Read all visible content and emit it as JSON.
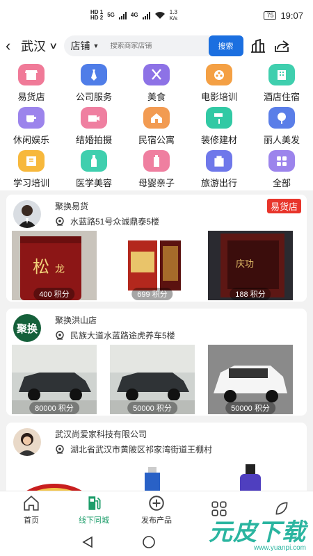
{
  "status_bar": {
    "hd1": "HD 1",
    "hd2": "HD 2",
    "net1": "5G",
    "net2": "4G",
    "speed": "1.3",
    "speed_unit": "K/s",
    "battery": "75",
    "time": "19:07"
  },
  "header": {
    "city": "武汉",
    "search_scope": "店铺",
    "search_placeholder": "搜索商家店铺",
    "search_button": "搜索"
  },
  "categories": [
    {
      "label": "易货店",
      "color": "#f07a98",
      "icon": "shop-icon"
    },
    {
      "label": "公司服务",
      "color": "#4f7de8",
      "icon": "tie-icon"
    },
    {
      "label": "美食",
      "color": "#8d72e6",
      "icon": "utensils-icon"
    },
    {
      "label": "电影培训",
      "color": "#f4a044",
      "icon": "film-reel-icon"
    },
    {
      "label": "酒店住宿",
      "color": "#3fcfae",
      "icon": "hotel-icon"
    },
    {
      "label": "休闲娱乐",
      "color": "#9c84ec",
      "icon": "coffee-icon"
    },
    {
      "label": "结婚拍摄",
      "color": "#ef7fa0",
      "icon": "camera-icon"
    },
    {
      "label": "民宿公寓",
      "color": "#f29b52",
      "icon": "house-icon"
    },
    {
      "label": "装修建材",
      "color": "#31c9a4",
      "icon": "paint-roller-icon"
    },
    {
      "label": "丽人美发",
      "color": "#5a7ee8",
      "icon": "mirror-icon"
    },
    {
      "label": "学习培训",
      "color": "#f7b83c",
      "icon": "book-icon"
    },
    {
      "label": "医学美容",
      "color": "#3fcfae",
      "icon": "bottle-icon"
    },
    {
      "label": "母婴亲子",
      "color": "#ef7fa0",
      "icon": "baby-bottle-icon"
    },
    {
      "label": "旅游出行",
      "color": "#6f78ea",
      "icon": "luggage-icon"
    },
    {
      "label": "全部",
      "color": "#9c84ec",
      "icon": "grid-icon"
    }
  ],
  "shops": [
    {
      "name": "聚换易货",
      "address": "水蓝路51号众诚鼎泰5楼",
      "tag": "易货店",
      "avatar": "person",
      "products": [
        {
          "points": "400 积分",
          "kind": "tea-can"
        },
        {
          "points": "699 积分",
          "kind": "liquor-box"
        },
        {
          "points": "188 积分",
          "kind": "wine-box"
        }
      ]
    },
    {
      "name": "聚换洪山店",
      "address": "民族大道水蓝路途虎养车5楼",
      "tag": "",
      "avatar_text": "聚换",
      "avatar": "logo",
      "products": [
        {
          "points": "80000 积分",
          "kind": "suv-dark"
        },
        {
          "points": "50000 积分",
          "kind": "suv-dark"
        },
        {
          "points": "50000 积分",
          "kind": "suv-white"
        }
      ]
    },
    {
      "name": "武汉尚爱家科技有限公司",
      "address": "湖北省武汉市黄陂区祁家湾街道王棚村",
      "tag": "",
      "avatar": "person2",
      "products": [
        {
          "points": "",
          "kind": "red-tin"
        },
        {
          "points": "",
          "kind": "spray"
        },
        {
          "points": "",
          "kind": "blue-bottle"
        }
      ]
    }
  ],
  "bottom_nav": [
    {
      "label": "首页",
      "icon": "home-icon"
    },
    {
      "label": "线下同城",
      "icon": "gas-station-icon",
      "active": true
    },
    {
      "label": "发布产品",
      "icon": "plus-circle-icon"
    },
    {
      "label": "",
      "icon": "grid-icon"
    },
    {
      "label": "",
      "icon": "leaf-icon"
    }
  ],
  "watermark": {
    "big": "元皮下载",
    "small": "www.yuanpi.com"
  }
}
